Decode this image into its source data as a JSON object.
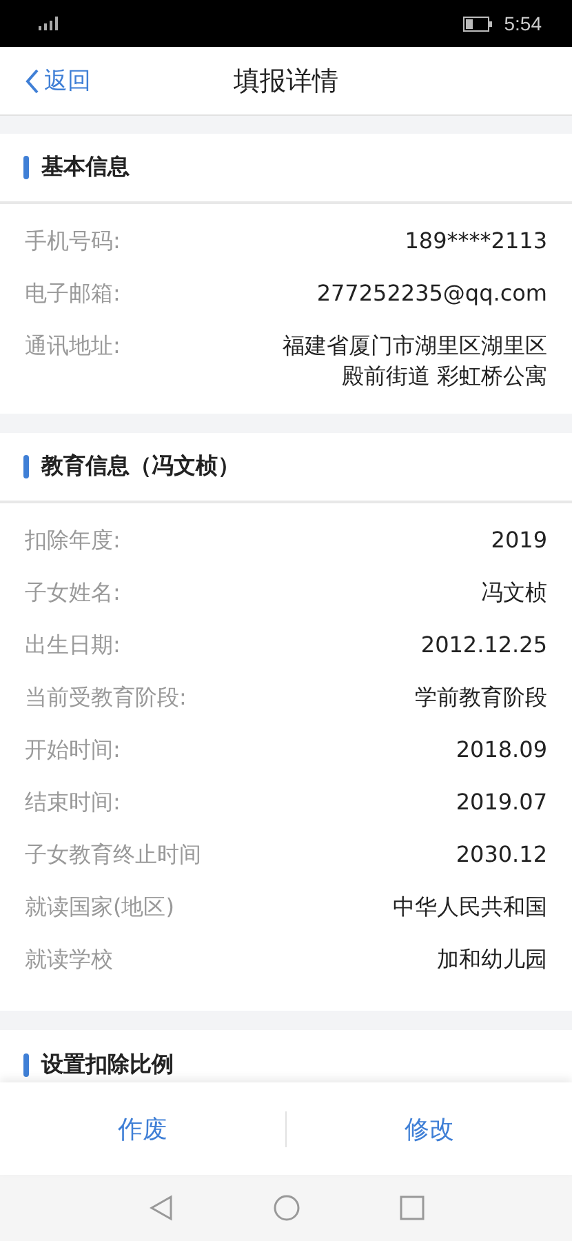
{
  "status_bar": {
    "time": "5:54"
  },
  "nav": {
    "back": "返回",
    "title": "填报详情"
  },
  "sections": [
    {
      "title": "基本信息",
      "rows": [
        {
          "label": "手机号码:",
          "value": "189****2113"
        },
        {
          "label": "电子邮箱:",
          "value": "277252235@qq.com"
        },
        {
          "label": "通讯地址:",
          "value": "福建省厦门市湖里区湖里区殿前街道 彩虹桥公寓"
        }
      ]
    },
    {
      "title": "教育信息（冯文桢）",
      "rows": [
        {
          "label": "扣除年度:",
          "value": "2019"
        },
        {
          "label": "子女姓名:",
          "value": "冯文桢"
        },
        {
          "label": "出生日期:",
          "value": "2012.12.25"
        },
        {
          "label": "当前受教育阶段:",
          "value": "学前教育阶段"
        },
        {
          "label": "开始时间:",
          "value": "2018.09"
        },
        {
          "label": "结束时间:",
          "value": "2019.07"
        },
        {
          "label": "子女教育终止时间",
          "value": "2030.12"
        },
        {
          "label": "就读国家(地区)",
          "value": "中华人民共和国"
        },
        {
          "label": "就读学校",
          "value": "加和幼儿园"
        }
      ]
    },
    {
      "title": "设置扣除比例"
    }
  ],
  "actions": [
    "作废",
    "修改"
  ]
}
